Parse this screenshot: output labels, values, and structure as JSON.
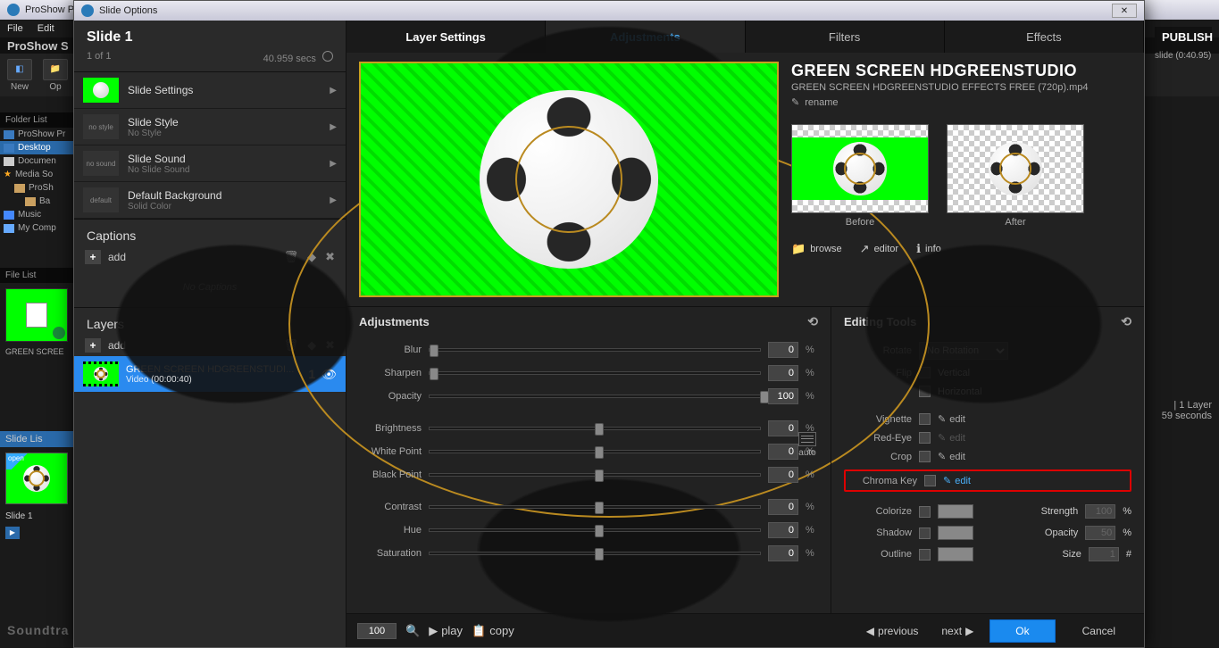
{
  "bgApp": {
    "title": "ProShow P",
    "menus": [
      "File",
      "Edit"
    ],
    "brand": "ProShow S",
    "tools": {
      "new": "New",
      "open": "Op"
    },
    "publish": "PUBLISH",
    "slideInfo": "slide (0:40.95)",
    "layerInfo": {
      "layers": "1 Layer",
      "secs": "59 seconds"
    }
  },
  "folderList": {
    "header": "Folder List",
    "items": [
      "ProShow Pr",
      "Desktop",
      "Documen",
      "Media So",
      "ProSh",
      "Ba",
      "Music",
      "My Comp"
    ]
  },
  "fileList": {
    "header": "File List",
    "label": "GREEN SCREE"
  },
  "slideList": {
    "header": "Slide Lis",
    "corner": "open",
    "caption": "Slide 1"
  },
  "soundtrack": "Soundtra",
  "dialog": {
    "title": "Slide Options",
    "slide": {
      "title": "Slide 1",
      "index": "1 of 1",
      "duration": "40.959 secs"
    },
    "options": [
      {
        "title": "Slide Settings",
        "sub": "",
        "thumb": "green"
      },
      {
        "title": "Slide Style",
        "sub": "No Style",
        "thumb": "no style"
      },
      {
        "title": "Slide Sound",
        "sub": "No Slide Sound",
        "thumb": "no sound"
      },
      {
        "title": "Default Background",
        "sub": "Solid Color",
        "thumb": "default"
      }
    ],
    "captions": {
      "header": "Captions",
      "add": "add",
      "empty": "No Captions"
    },
    "layers": {
      "header": "Layers",
      "add": "add",
      "item": {
        "title": "GREEN SCREEN HDGREENSTUDI...",
        "sub": "Video (00:00:40)",
        "num": "1"
      }
    },
    "tabs": [
      "Layer Settings",
      "Adjustments",
      "Filters",
      "Effects"
    ],
    "media": {
      "title": "GREEN SCREEN HDGREENSTUDIO",
      "file": "GREEN SCREEN HDGREENSTUDIO EFFECTS FREE (720p).mp4",
      "rename": "rename",
      "before": "Before",
      "after": "After",
      "browse": "browse",
      "editor": "editor",
      "info": "info"
    },
    "adjustments": {
      "header": "Adjustments",
      "auto": "auto",
      "sliders": [
        {
          "name": "Blur",
          "val": "0",
          "pos": 0
        },
        {
          "name": "Sharpen",
          "val": "0",
          "pos": 0
        },
        {
          "name": "Opacity",
          "val": "100",
          "pos": 100
        }
      ],
      "sliders2": [
        {
          "name": "Brightness",
          "val": "0",
          "pos": 50
        },
        {
          "name": "White Point",
          "val": "0",
          "pos": 50
        },
        {
          "name": "Black Point",
          "val": "0",
          "pos": 50
        }
      ],
      "sliders3": [
        {
          "name": "Contrast",
          "val": "0",
          "pos": 50
        },
        {
          "name": "Hue",
          "val": "0",
          "pos": 50
        },
        {
          "name": "Saturation",
          "val": "0",
          "pos": 50
        }
      ]
    },
    "editing": {
      "header": "Editing Tools",
      "rotate": {
        "label": "Rotate",
        "value": "No Rotation"
      },
      "flip": {
        "label": "Flip",
        "vertical": "Vertical",
        "horizontal": "Horizontal"
      },
      "vignette": "Vignette",
      "redeye": "Red-Eye",
      "crop": "Crop",
      "chroma": "Chroma Key",
      "edit": "edit",
      "colorize": {
        "label": "Colorize",
        "strengthLabel": "Strength",
        "strength": "100"
      },
      "shadow": {
        "label": "Shadow",
        "opacityLabel": "Opacity",
        "opacity": "50"
      },
      "outline": {
        "label": "Outline",
        "sizeLabel": "Size",
        "size": "1"
      },
      "pct": "%",
      "hash": "#"
    },
    "footer": {
      "zoom": "100",
      "play": "play",
      "copy": "copy",
      "prev": "previous",
      "next": "next",
      "ok": "Ok",
      "cancel": "Cancel"
    }
  }
}
